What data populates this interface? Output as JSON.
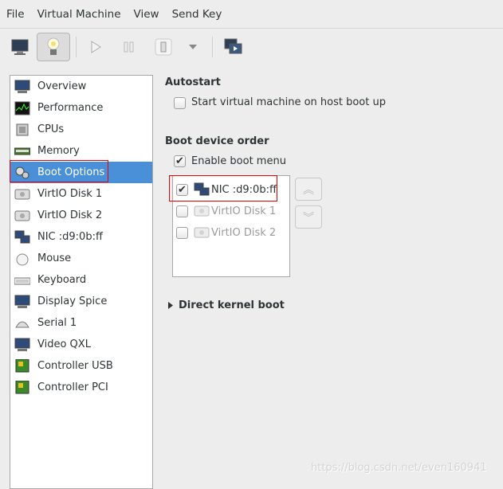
{
  "menu": [
    "File",
    "Virtual Machine",
    "View",
    "Send Key"
  ],
  "toolbar": {
    "icons": [
      "monitor-icon",
      "lightbulb-icon",
      "play-icon",
      "pause-icon",
      "power-icon",
      "dropdown-icon",
      "screens-icon"
    ]
  },
  "sidebar": {
    "items": [
      {
        "label": "Overview",
        "icon": "monitor-icon"
      },
      {
        "label": "Performance",
        "icon": "performance-graph-icon"
      },
      {
        "label": "CPUs",
        "icon": "cpu-icon"
      },
      {
        "label": "Memory",
        "icon": "memory-icon"
      },
      {
        "label": "Boot Options",
        "icon": "gears-icon",
        "selected": true
      },
      {
        "label": "VirtIO Disk 1",
        "icon": "disk-icon"
      },
      {
        "label": "VirtIO Disk 2",
        "icon": "disk-icon"
      },
      {
        "label": "NIC :d9:0b:ff",
        "icon": "network-icon"
      },
      {
        "label": "Mouse",
        "icon": "mouse-icon"
      },
      {
        "label": "Keyboard",
        "icon": "keyboard-icon"
      },
      {
        "label": "Display Spice",
        "icon": "monitor-icon"
      },
      {
        "label": "Serial 1",
        "icon": "serial-icon"
      },
      {
        "label": "Video QXL",
        "icon": "monitor-icon"
      },
      {
        "label": "Controller USB",
        "icon": "controller-card-icon"
      },
      {
        "label": "Controller PCI",
        "icon": "controller-card-icon"
      }
    ]
  },
  "autostart": {
    "heading": "Autostart",
    "checkbox_label": "Start virtual machine on host boot up",
    "checked": false
  },
  "boot": {
    "heading": "Boot device order",
    "enable_menu_label": "Enable boot menu",
    "enable_menu_checked": true,
    "devices": [
      {
        "label": "NIC :d9:0b:ff",
        "checked": true
      },
      {
        "label": "VirtIO Disk 1",
        "checked": false
      },
      {
        "label": "VirtIO Disk 2",
        "checked": false
      }
    ]
  },
  "kernel": {
    "label": "Direct kernel boot"
  },
  "watermark": "https://blog.csdn.net/even160941",
  "colors": {
    "selection": "#4a90d9",
    "highlight_box": "#ee0000"
  }
}
